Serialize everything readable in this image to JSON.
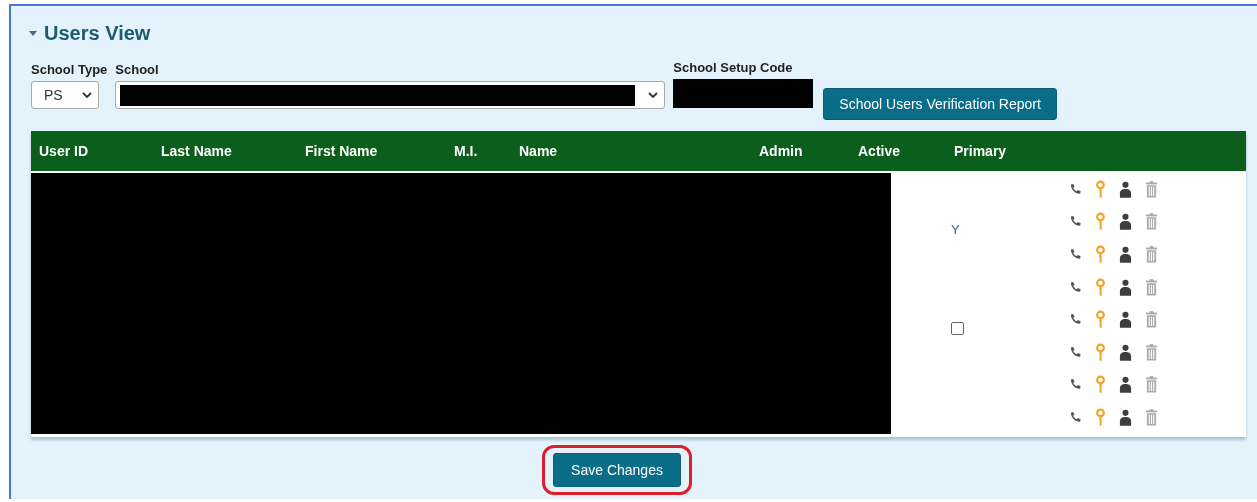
{
  "panel": {
    "title": "Users View",
    "expanded": true
  },
  "filters": {
    "school_type_label": "School Type",
    "school_type_value": "PS",
    "school_label": "School",
    "setup_code_label": "School Setup Code",
    "report_button": "School Users Verification Report"
  },
  "table": {
    "columns": [
      "User ID",
      "Last Name",
      "First Name",
      "M.I.",
      "Name",
      "Admin",
      "Active",
      "Primary"
    ],
    "rows": [
      {
        "primary": {
          "kind": "empty"
        }
      },
      {
        "primary": {
          "kind": "text",
          "text": "Y"
        }
      },
      {
        "primary": {
          "kind": "empty"
        }
      },
      {
        "primary": {
          "kind": "empty"
        }
      },
      {
        "primary": {
          "kind": "checkbox",
          "checked": false
        }
      },
      {
        "primary": {
          "kind": "empty"
        }
      },
      {
        "primary": {
          "kind": "empty"
        }
      },
      {
        "primary": {
          "kind": "empty"
        }
      }
    ]
  },
  "save_button": "Save Changes"
}
